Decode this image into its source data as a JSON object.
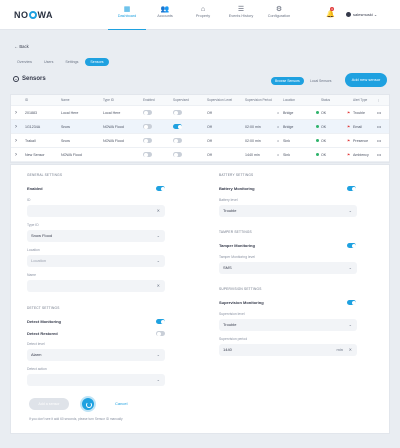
{
  "topbar": {
    "logo": "NOWA",
    "nav": [
      {
        "label": "Dashboard",
        "icon": "grid-icon",
        "glyph": "▦",
        "active": true
      },
      {
        "label": "Accounts",
        "icon": "users-icon",
        "glyph": "👥",
        "active": false
      },
      {
        "label": "Property",
        "icon": "home-icon",
        "glyph": "⌂",
        "active": false
      },
      {
        "label": "Events History",
        "icon": "list-icon",
        "glyph": "☰",
        "active": false
      },
      {
        "label": "Configuration",
        "icon": "gear-icon",
        "glyph": "⚙",
        "active": false
      }
    ],
    "notif_count": "4",
    "user": "salesmuski"
  },
  "back_label": "Back",
  "tabs": [
    "Overview",
    "Users",
    "Settings",
    "Sensors"
  ],
  "section_title": "Sensors",
  "actions": {
    "sensor_search": "Browse Sensors",
    "local_sensors": "Local Sensors",
    "add_sensor": "Add new sensor"
  },
  "table": {
    "headers": [
      "ID",
      "Name",
      "Type ID",
      "Enabled",
      "Supervised",
      "Supervision Level",
      "Supervision Period",
      "Location",
      "Status",
      "Alert Type"
    ],
    "rows": [
      {
        "id": "201883",
        "name": "Local Here",
        "type": "Local Here",
        "enabled": false,
        "supervised": false,
        "level": "Off",
        "period": "",
        "location": "Bridge",
        "status": "OK",
        "alert": "Trouble"
      },
      {
        "id": "1G1234A",
        "name": "Snow",
        "type": "NOWA Flood",
        "enabled": false,
        "supervised": true,
        "level": "Off",
        "period": "02:00 min",
        "location": "Bridge",
        "status": "OK",
        "alert": "Email"
      },
      {
        "id": "Trakall",
        "name": "Snow",
        "type": "NOWA Flood",
        "enabled": false,
        "supervised": false,
        "level": "Off",
        "period": "02:00 min",
        "location": "Sink",
        "status": "OK",
        "alert": "Presence"
      },
      {
        "id": "New Sensor",
        "name": "NOWA Flood",
        "type": "",
        "enabled": false,
        "supervised": false,
        "level": "Off",
        "period": "1440 min",
        "location": "Sink",
        "status": "OK",
        "alert": "Ambiency"
      }
    ]
  },
  "form": {
    "general": {
      "heading": "GENERAL SETTINGS",
      "enabled_label": "Enabled",
      "id_label": "ID",
      "id_value": "",
      "type_label": "Type ID",
      "type_value": "Snow Flood",
      "location_label": "Location",
      "location_value": "Location",
      "name_label": "Name",
      "name_value": ""
    },
    "detect": {
      "heading": "DETECT SETTINGS",
      "monitoring_label": "Detect Monitoring",
      "restored_label": "Detect Restored",
      "level_label": "Detect level",
      "level_value": "Alarm",
      "action_label": "Detect action",
      "action_value": ""
    },
    "battery": {
      "heading": "BATTERY SETTINGS",
      "monitoring_label": "Battery Monitoring",
      "level_label": "Battery level",
      "level_value": "Trouble"
    },
    "tamper": {
      "heading": "TAMPER SETTINGS",
      "monitoring_label": "Tamper Monitoring",
      "level_label": "Tamper Monitoring level",
      "level_value": "SMS"
    },
    "supervision": {
      "heading": "SUPERVISION SETTINGS",
      "monitoring_label": "Supervision Monitoring",
      "level_label": "Supervision level",
      "level_value": "Trouble",
      "period_label": "Supervision period",
      "period_value": "1440",
      "period_unit": "min"
    },
    "add_button": "Add a sensor",
    "cancel": "Cancel",
    "hint": "If you don't see it add 60 seconds, please turn Sensor ID manually"
  }
}
